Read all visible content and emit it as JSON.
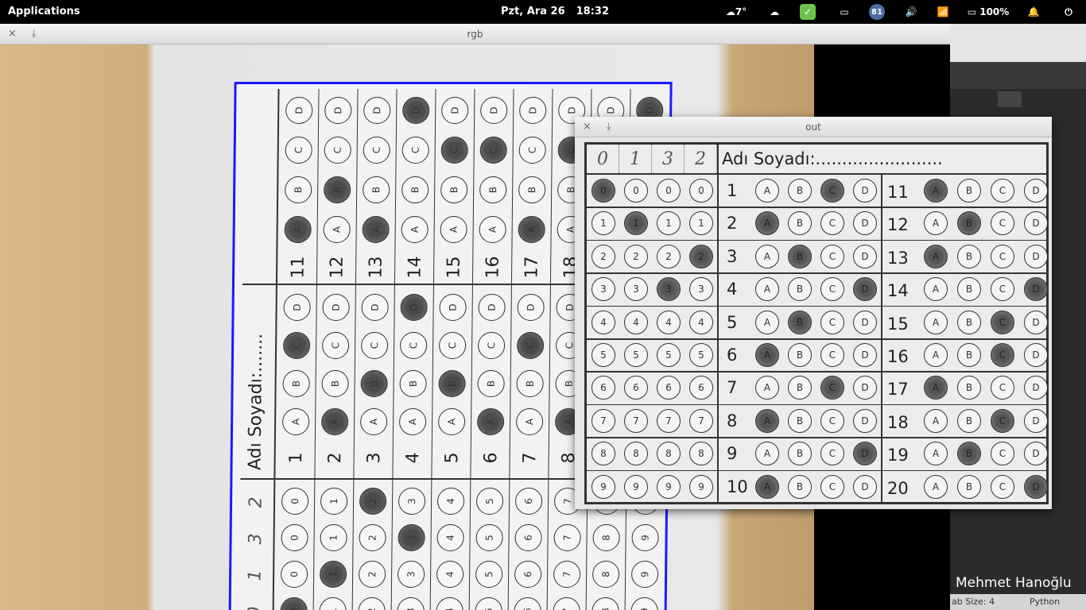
{
  "topbar": {
    "applications": "Applications",
    "date": "Pzt, Ara 26",
    "time": "18:32",
    "weather": "7°",
    "badge": "81",
    "battery": "100%"
  },
  "windows": {
    "rgb_title": "rgb",
    "out_title": "out",
    "close_glyph": "×",
    "pin_glyph": "⤓"
  },
  "editor": {
    "tab_size": "ab Size: 4",
    "language": "Python"
  },
  "user_label": "Mehmet Hanoğlu",
  "form": {
    "name_label": "Adı Soyadı:........................",
    "header_digits": [
      "0",
      "1",
      "3",
      "2"
    ],
    "digit_options": [
      "0",
      "1",
      "2",
      "3",
      "4",
      "5",
      "6",
      "7",
      "8",
      "9"
    ],
    "digit_filled": [
      0,
      1,
      3,
      2
    ],
    "choice_labels": [
      "A",
      "B",
      "C",
      "D"
    ],
    "questions_left": [
      "1",
      "2",
      "3",
      "4",
      "5",
      "6",
      "7",
      "8",
      "9",
      "10"
    ],
    "questions_right": [
      "11",
      "12",
      "13",
      "14",
      "15",
      "16",
      "17",
      "18",
      "19",
      "20"
    ],
    "answers_left": [
      2,
      0,
      1,
      3,
      1,
      0,
      2,
      0,
      3,
      0
    ],
    "answers_right": [
      0,
      1,
      0,
      3,
      2,
      2,
      0,
      2,
      1,
      3
    ]
  }
}
